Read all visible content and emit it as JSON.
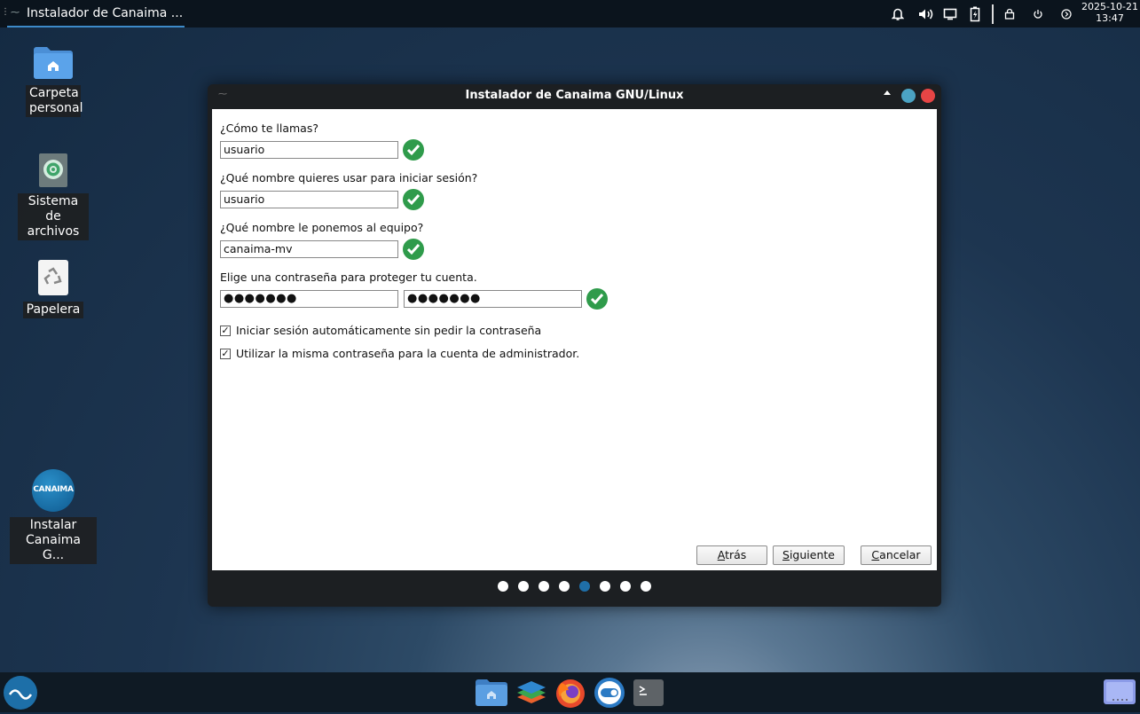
{
  "top_panel": {
    "task_title": "Instalador de Canaima ...",
    "clock": {
      "date": "2025-10-21",
      "time": "13:47"
    }
  },
  "desktop": {
    "icons": [
      {
        "label": "Carpeta personal",
        "icon": "home-folder-icon"
      },
      {
        "label": "Sistema de archivos",
        "icon": "filesystem-icon"
      },
      {
        "label": "Papelera",
        "icon": "trash-icon"
      },
      {
        "label": "Instalar Canaima G...",
        "icon": "canaima-installer-icon",
        "logo_text": "CANAIMA"
      }
    ]
  },
  "window": {
    "title": "Instalador de Canaima GNU/Linux",
    "form": {
      "name_question": "¿Cómo te llamas?",
      "name_value": "usuario",
      "login_question": "¿Qué nombre quieres usar para iniciar sesión?",
      "login_value": "usuario",
      "host_question": "¿Qué nombre le ponemos al equipo?",
      "host_value": "canaima-mv",
      "password_question": "Elige una contraseña para proteger tu cuenta.",
      "password_mask": "●●●●●●●",
      "confirm_mask": "●●●●●●●",
      "autologin_label": "Iniciar sesión automáticamente sin pedir la contraseña",
      "autologin_checked": true,
      "same_admin_label": "Utilizar la misma contraseña para la cuenta de administrador.",
      "same_admin_checked": true
    },
    "buttons": {
      "back_mnemonic": "A",
      "back_rest": "trás",
      "next_mnemonic": "S",
      "next_rest": "iguiente",
      "cancel_mnemonic": "C",
      "cancel_rest": "ancelar"
    },
    "steps": {
      "total": 8,
      "current": 5
    }
  },
  "colors": {
    "accent": "#3d8ac8",
    "valid": "#2f9b4b",
    "close": "#e74545",
    "maximize": "#4ba3c3",
    "step_active": "#1f6fa8"
  }
}
